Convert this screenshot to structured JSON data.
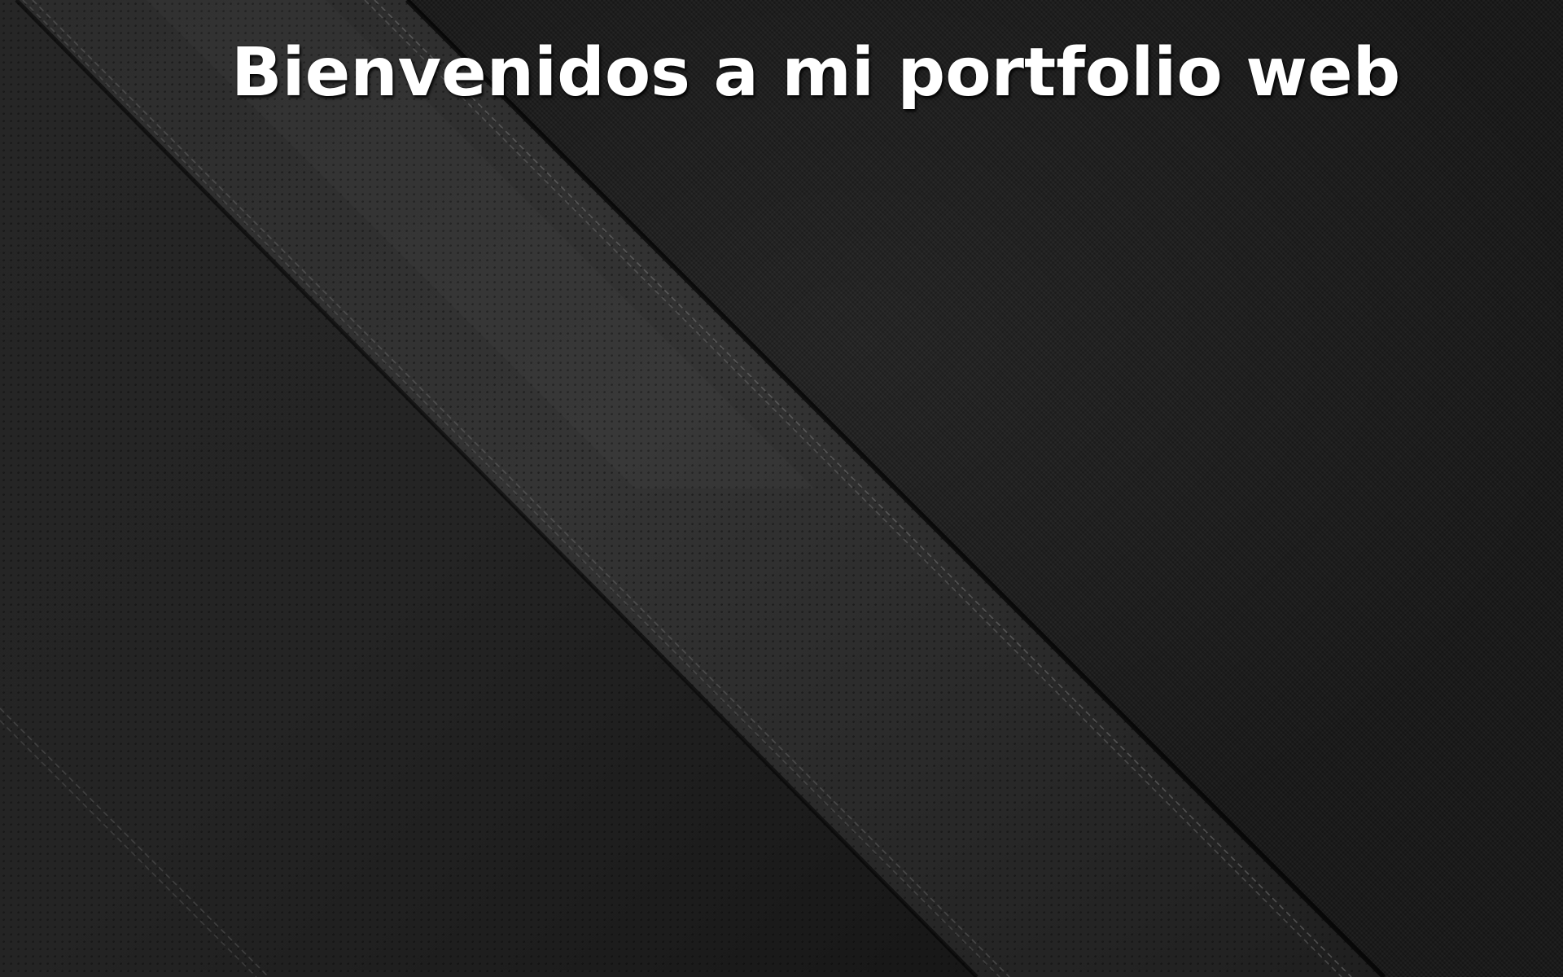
{
  "header": {
    "title": "Bienvenidos a mi portfolio web"
  },
  "colors": {
    "background": "#171717",
    "band_light": "#2e2e2e",
    "band_dark": "#1e1e1e",
    "title_text": "#ffffff"
  },
  "background": {
    "style": "dark perforated leather with diagonal stitched bands"
  }
}
